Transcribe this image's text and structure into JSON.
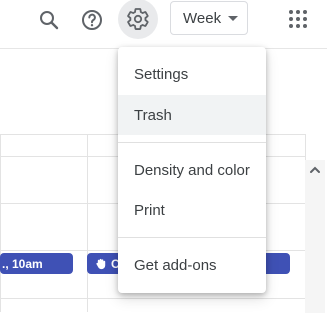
{
  "header": {
    "view_selector_label": "Week",
    "icons": [
      "search-icon",
      "help-icon",
      "settings-gear-icon",
      "apps-grid-icon"
    ]
  },
  "settings_menu": {
    "items": [
      {
        "label": "Settings"
      },
      {
        "label": "Trash"
      },
      {
        "label": "Density and color"
      },
      {
        "label": "Print"
      },
      {
        "label": "Get add-ons"
      }
    ]
  },
  "calendar": {
    "events": [
      {
        "label": "., 10am"
      },
      {
        "label": "C"
      }
    ]
  },
  "colors": {
    "event": "#3f51b5",
    "menu_hover": "#f1f3f4",
    "icon": "#5f6368"
  }
}
